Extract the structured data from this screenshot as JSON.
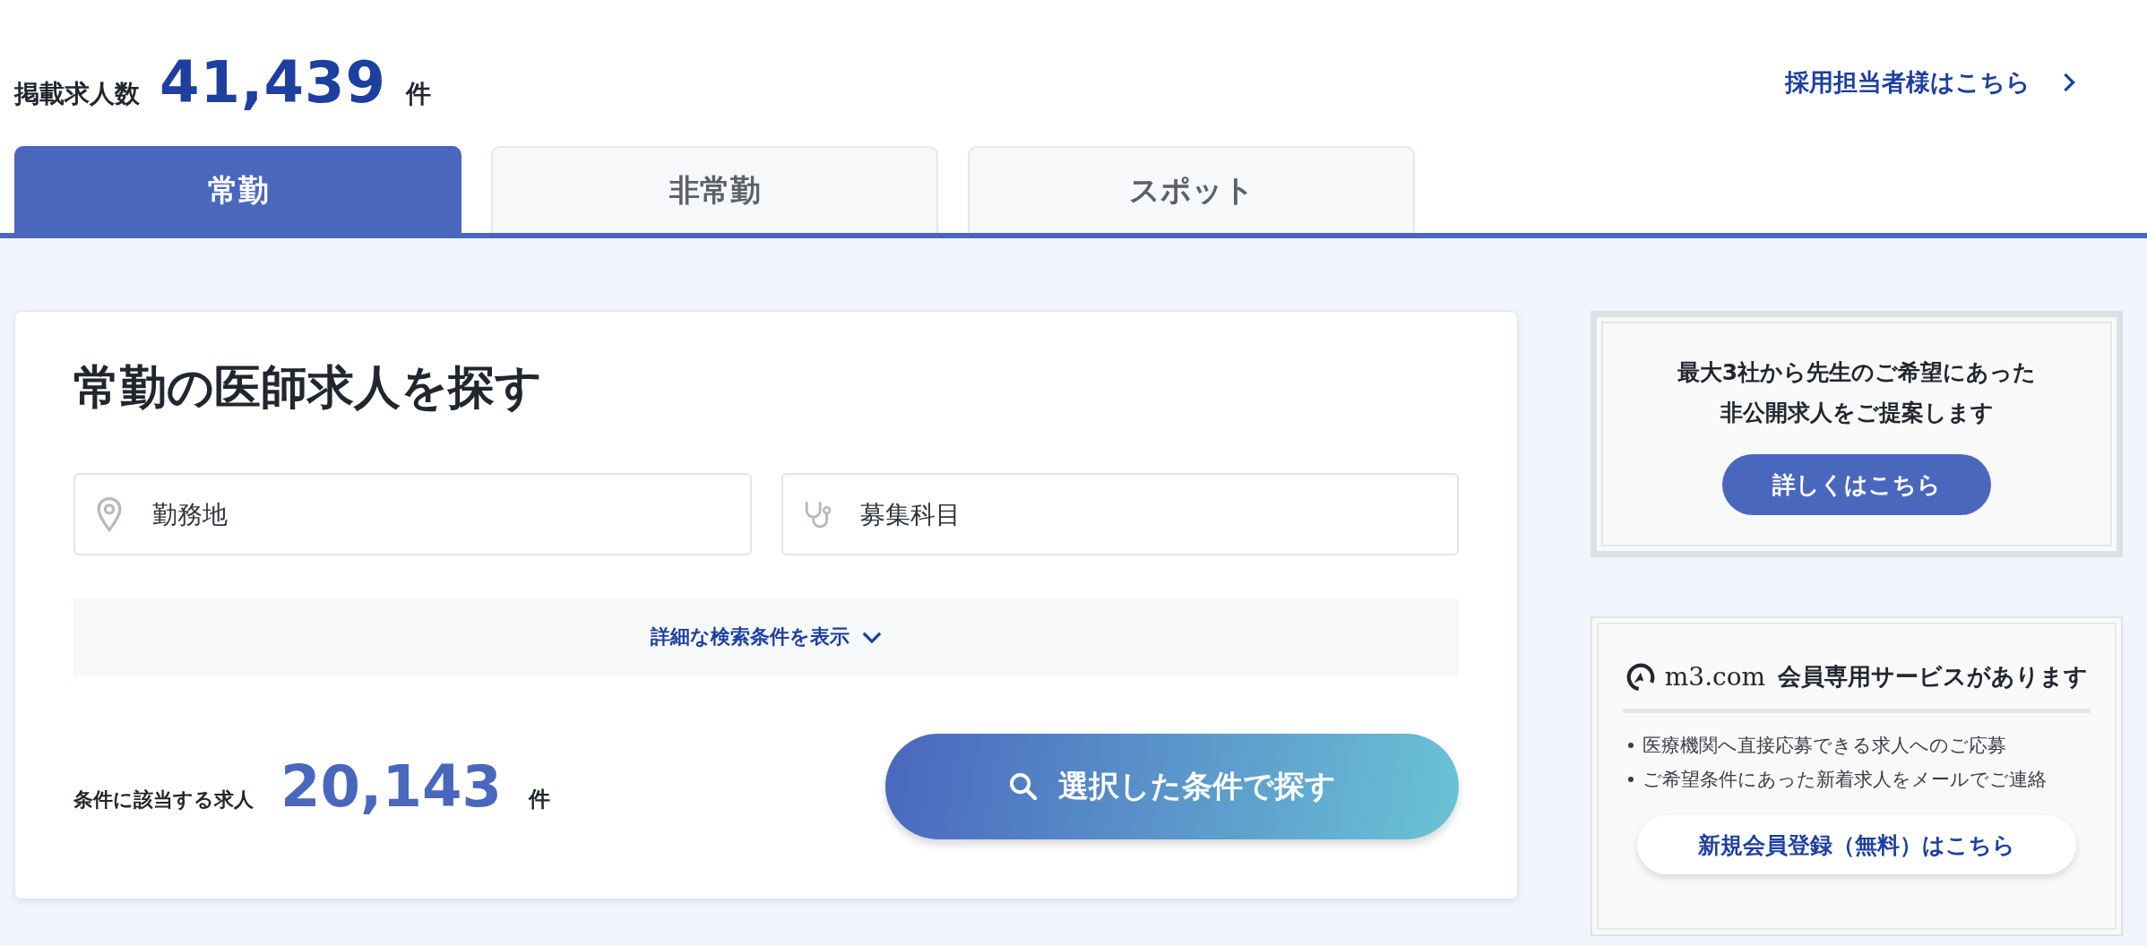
{
  "header": {
    "count_label": "掲載求人数",
    "count": "41,439",
    "count_unit": "件",
    "employer_link": "採用担当者様はこちら"
  },
  "tabs": [
    {
      "label": "常勤",
      "selected": true
    },
    {
      "label": "非常勤",
      "selected": false
    },
    {
      "label": "スポット",
      "selected": false
    }
  ],
  "search_card": {
    "title": "常勤の医師求人を探す",
    "fields": [
      {
        "kind": "location",
        "placeholder": "勤務地"
      },
      {
        "kind": "specialty",
        "placeholder": "募集科目"
      }
    ],
    "detail_toggle": "詳細な検索条件を表示",
    "result_label": "条件に該当する求人",
    "result_count": "20,143",
    "result_unit": "件",
    "search_button": "選択した条件で探す"
  },
  "proposal_panel": {
    "lines": [
      "最大3社から先生のご希望にあった",
      "非公開求人をご提案します"
    ],
    "button": "詳しくはこちら"
  },
  "member_panel": {
    "logo_text": "m3.com",
    "title": "会員専用サービスがあります",
    "benefits": [
      "医療機関へ直接応募できる求人へのご応募",
      "ご希望条件にあった新着求人をメールでご連絡"
    ],
    "button": "新規会員登録（無料）はこちら"
  }
}
